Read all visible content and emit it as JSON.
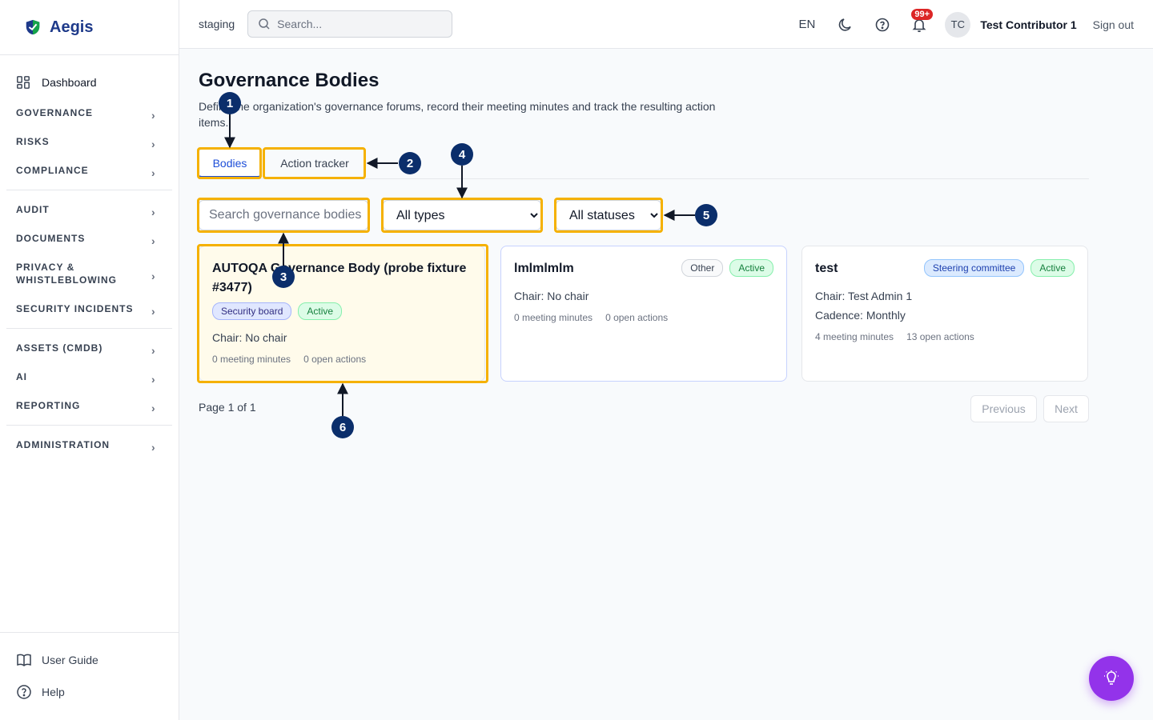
{
  "brand": {
    "name": "Aegis"
  },
  "sidebar": {
    "dashboard": "Dashboard",
    "groups": [
      [
        "GOVERNANCE",
        "RISKS",
        "COMPLIANCE"
      ],
      [
        "AUDIT",
        "DOCUMENTS",
        "PRIVACY & WHISTLEBLOWING",
        "SECURITY INCIDENTS"
      ],
      [
        "ASSETS (CMDB)",
        "AI",
        "REPORTING"
      ],
      [
        "ADMINISTRATION"
      ]
    ],
    "footer": {
      "user_guide": "User Guide",
      "help": "Help"
    }
  },
  "topbar": {
    "env": "staging",
    "search_placeholder": "Search...",
    "lang": "EN",
    "notif_count": "99+",
    "avatar_initials": "TC",
    "user_name": "Test Contributor 1",
    "sign_out": "Sign out"
  },
  "page": {
    "title": "Governance Bodies",
    "description": "Define the organization's governance forums, record their meeting minutes and track the resulting action items.",
    "tabs": {
      "bodies": "Bodies",
      "actions": "Action tracker"
    },
    "filters": {
      "search_placeholder": "Search governance bodies",
      "type_selected": "All types",
      "status_selected": "All statuses"
    },
    "cards": [
      {
        "name": "AUTOQA Governance Body (probe fixture #3477)",
        "type": "Security board",
        "status": "Active",
        "chair": "Chair: No chair",
        "minutes": "0 meeting minutes",
        "actions": "0 open actions"
      },
      {
        "name": "lmlmlmlm",
        "type": "Other",
        "status": "Active",
        "chair": "Chair: No chair",
        "minutes": "0 meeting minutes",
        "actions": "0 open actions"
      },
      {
        "name": "test",
        "type": "Steering committee",
        "status": "Active",
        "chair": "Chair: Test Admin 1",
        "cadence": "Cadence: Monthly",
        "minutes": "4 meeting minutes",
        "actions": "13 open actions"
      }
    ],
    "pager": {
      "text": "Page 1 of 1",
      "previous": "Previous",
      "next": "Next"
    }
  },
  "annotations": [
    "1",
    "2",
    "3",
    "4",
    "5",
    "6"
  ],
  "colors": {
    "highlight": "#f5b100",
    "marker": "#0b2e6b",
    "accent": "#1d4ed8",
    "fab": "#9333ea"
  }
}
